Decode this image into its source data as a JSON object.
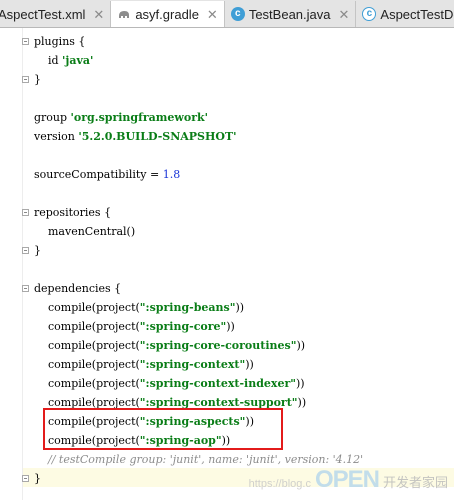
{
  "tabs": [
    {
      "label": "AspectTest.xml",
      "icon": "xml-file-icon",
      "active": false
    },
    {
      "label": "asyf.gradle",
      "icon": "gradle-elephant-icon",
      "active": true
    },
    {
      "label": "TestBean.java",
      "icon": "java-class-icon",
      "active": false
    },
    {
      "label": "AspectTestDoM",
      "icon": "java-class-icon",
      "active": false
    }
  ],
  "code": {
    "l1": "plugins {",
    "l2_pre": "    id ",
    "l2_str": "'java'",
    "l3": "}",
    "l5_pre": "group ",
    "l5_str": "'org.springframework'",
    "l6_pre": "version ",
    "l6_str": "'5.2.0.BUILD-SNAPSHOT'",
    "l8_pre": "sourceCompatibility = ",
    "l8_num": "1.8",
    "l10": "repositories {",
    "l11": "    mavenCentral()",
    "l12": "}",
    "l14": "dependencies {",
    "deps": [
      {
        "pre": "    compile(project(",
        "str": "\":spring-beans\"",
        "post": "))"
      },
      {
        "pre": "    compile(project(",
        "str": "\":spring-core\"",
        "post": "))"
      },
      {
        "pre": "    compile(project(",
        "str": "\":spring-core-coroutines\"",
        "post": "))"
      },
      {
        "pre": "    compile(project(",
        "str": "\":spring-context\"",
        "post": "))"
      },
      {
        "pre": "    compile(project(",
        "str": "\":spring-context-indexer\"",
        "post": "))"
      },
      {
        "pre": "    compile(project(",
        "str": "\":spring-context-support\"",
        "post": "))"
      },
      {
        "pre": "    compile(project(",
        "str": "\":spring-aspects\"",
        "post": "))"
      },
      {
        "pre": "    compile(project(",
        "str": "\":spring-aop\"",
        "post": "))"
      }
    ],
    "comment": "    // testCompile group: 'junit', name: 'junit', version: '4.12'",
    "close": "}"
  },
  "watermark": {
    "blog": "https://blog.c",
    "brand": "OPEN",
    "cn": "开发者家园"
  },
  "colors": {
    "string": "#0a7d17",
    "number": "#1a35d8",
    "comment": "#8c8c8c",
    "highlight_box": "#e31b1b"
  }
}
